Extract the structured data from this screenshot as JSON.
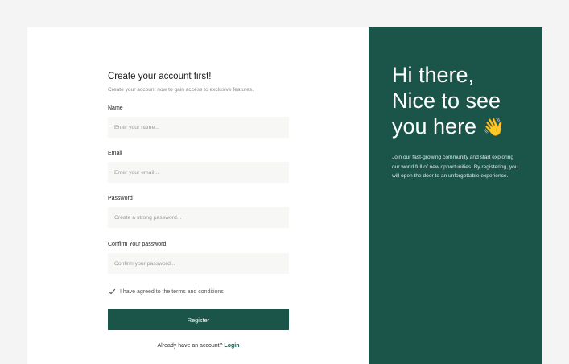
{
  "form": {
    "title": "Create your account first!",
    "subtitle": "Create your account now to gain access to exclusive features.",
    "fields": [
      {
        "label": "Name",
        "placeholder": "Enter your name..."
      },
      {
        "label": "Email",
        "placeholder": "Enter your email..."
      },
      {
        "label": "Password",
        "placeholder": "Create a strong password..."
      },
      {
        "label": "Confirm Your password",
        "placeholder": "Confirm your password..."
      }
    ],
    "terms_label": "I have agreed to the terms and conditions",
    "terms_checked": true,
    "register_label": "Register",
    "login_prompt": "Already have an account?",
    "login_link": "Login"
  },
  "hero": {
    "line1": "Hi there,",
    "line2": "Nice to see",
    "line3": "you here",
    "wave_emoji": "👋",
    "wave_icon": "waving-hand-icon",
    "description": "Join our fast-growing community and start exploring our world full of new opportunities. By registering, you will open the door to an unforgettable experience."
  },
  "colors": {
    "brand": "#1b5449",
    "page_bg": "#f4f4f4",
    "input_bg": "#f7f8f6"
  }
}
